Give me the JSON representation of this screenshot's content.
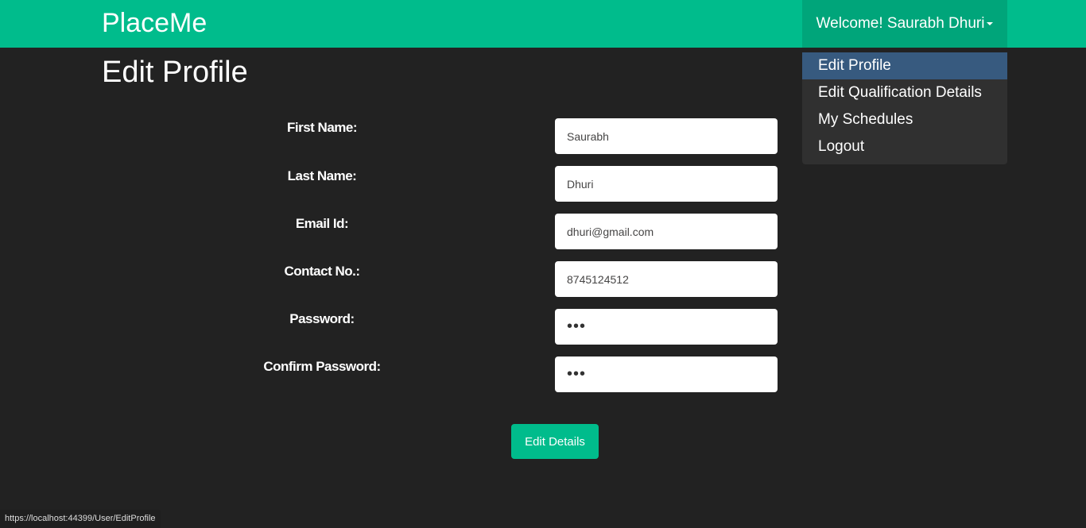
{
  "navbar": {
    "brand": "PlaceMe",
    "user_menu_label": "Welcome! Saurabh Dhuri",
    "dropdown_items": [
      {
        "label": "Edit Profile",
        "active": true
      },
      {
        "label": "Edit Qualification Details",
        "active": false
      },
      {
        "label": "My Schedules",
        "active": false
      },
      {
        "label": "Logout",
        "active": false
      }
    ]
  },
  "page": {
    "title": "Edit Profile"
  },
  "form": {
    "fields": [
      {
        "label": "First Name:",
        "value": "Saurabh",
        "type": "text"
      },
      {
        "label": "Last Name:",
        "value": "Dhuri",
        "type": "text"
      },
      {
        "label": "Email Id:",
        "value": "dhuri@gmail.com",
        "type": "email"
      },
      {
        "label": "Contact No.:",
        "value": "8745124512",
        "type": "text"
      },
      {
        "label": "Password:",
        "value": "•••",
        "type": "password"
      },
      {
        "label": "Confirm Password:",
        "value": "•••",
        "type": "password"
      }
    ],
    "submit_label": "Edit Details"
  },
  "status_bar": {
    "url": "https://localhost:44399/User/EditProfile"
  }
}
